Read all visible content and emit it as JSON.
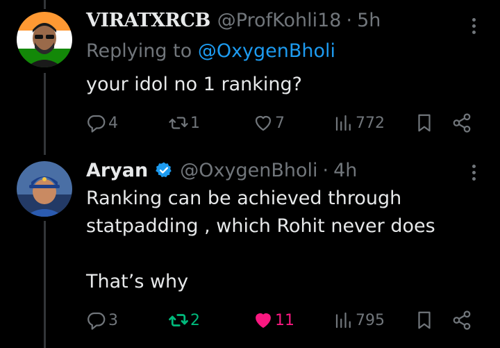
{
  "colors": {
    "background": "#000000",
    "text_primary": "#e7e9ea",
    "text_secondary": "#71767b",
    "link": "#1d9bf0",
    "retweet_active": "#00ba7c",
    "like_active": "#f91880",
    "verified": "#1d9bf0"
  },
  "tweets": [
    {
      "display_name": "VIRATXRCB",
      "handle": "@ProfKohli18",
      "separator": "·",
      "time": "5h",
      "replying_to_label": "Replying to",
      "replying_to_handle": "@OxygenBholi",
      "text": "your idol no 1 ranking?",
      "replies": "4",
      "retweets": "1",
      "likes": "7",
      "views": "772",
      "retweeted": false,
      "liked": false,
      "icons": [
        "reply-icon",
        "retweet-icon",
        "like-icon",
        "views-icon",
        "bookmark-icon",
        "share-icon",
        "more-icon"
      ]
    },
    {
      "display_name": "Aryan",
      "verified": true,
      "handle": "@OxygenBholi",
      "separator": "·",
      "time": "4h",
      "text": "Ranking can be achieved through\nstatpadding , which Rohit never does\n\nThat’s why",
      "replies": "3",
      "retweets": "2",
      "likes": "11",
      "views": "795",
      "retweeted": true,
      "liked": true,
      "icons": [
        "reply-icon",
        "retweet-icon",
        "like-icon",
        "views-icon",
        "bookmark-icon",
        "share-icon",
        "more-icon"
      ]
    }
  ]
}
